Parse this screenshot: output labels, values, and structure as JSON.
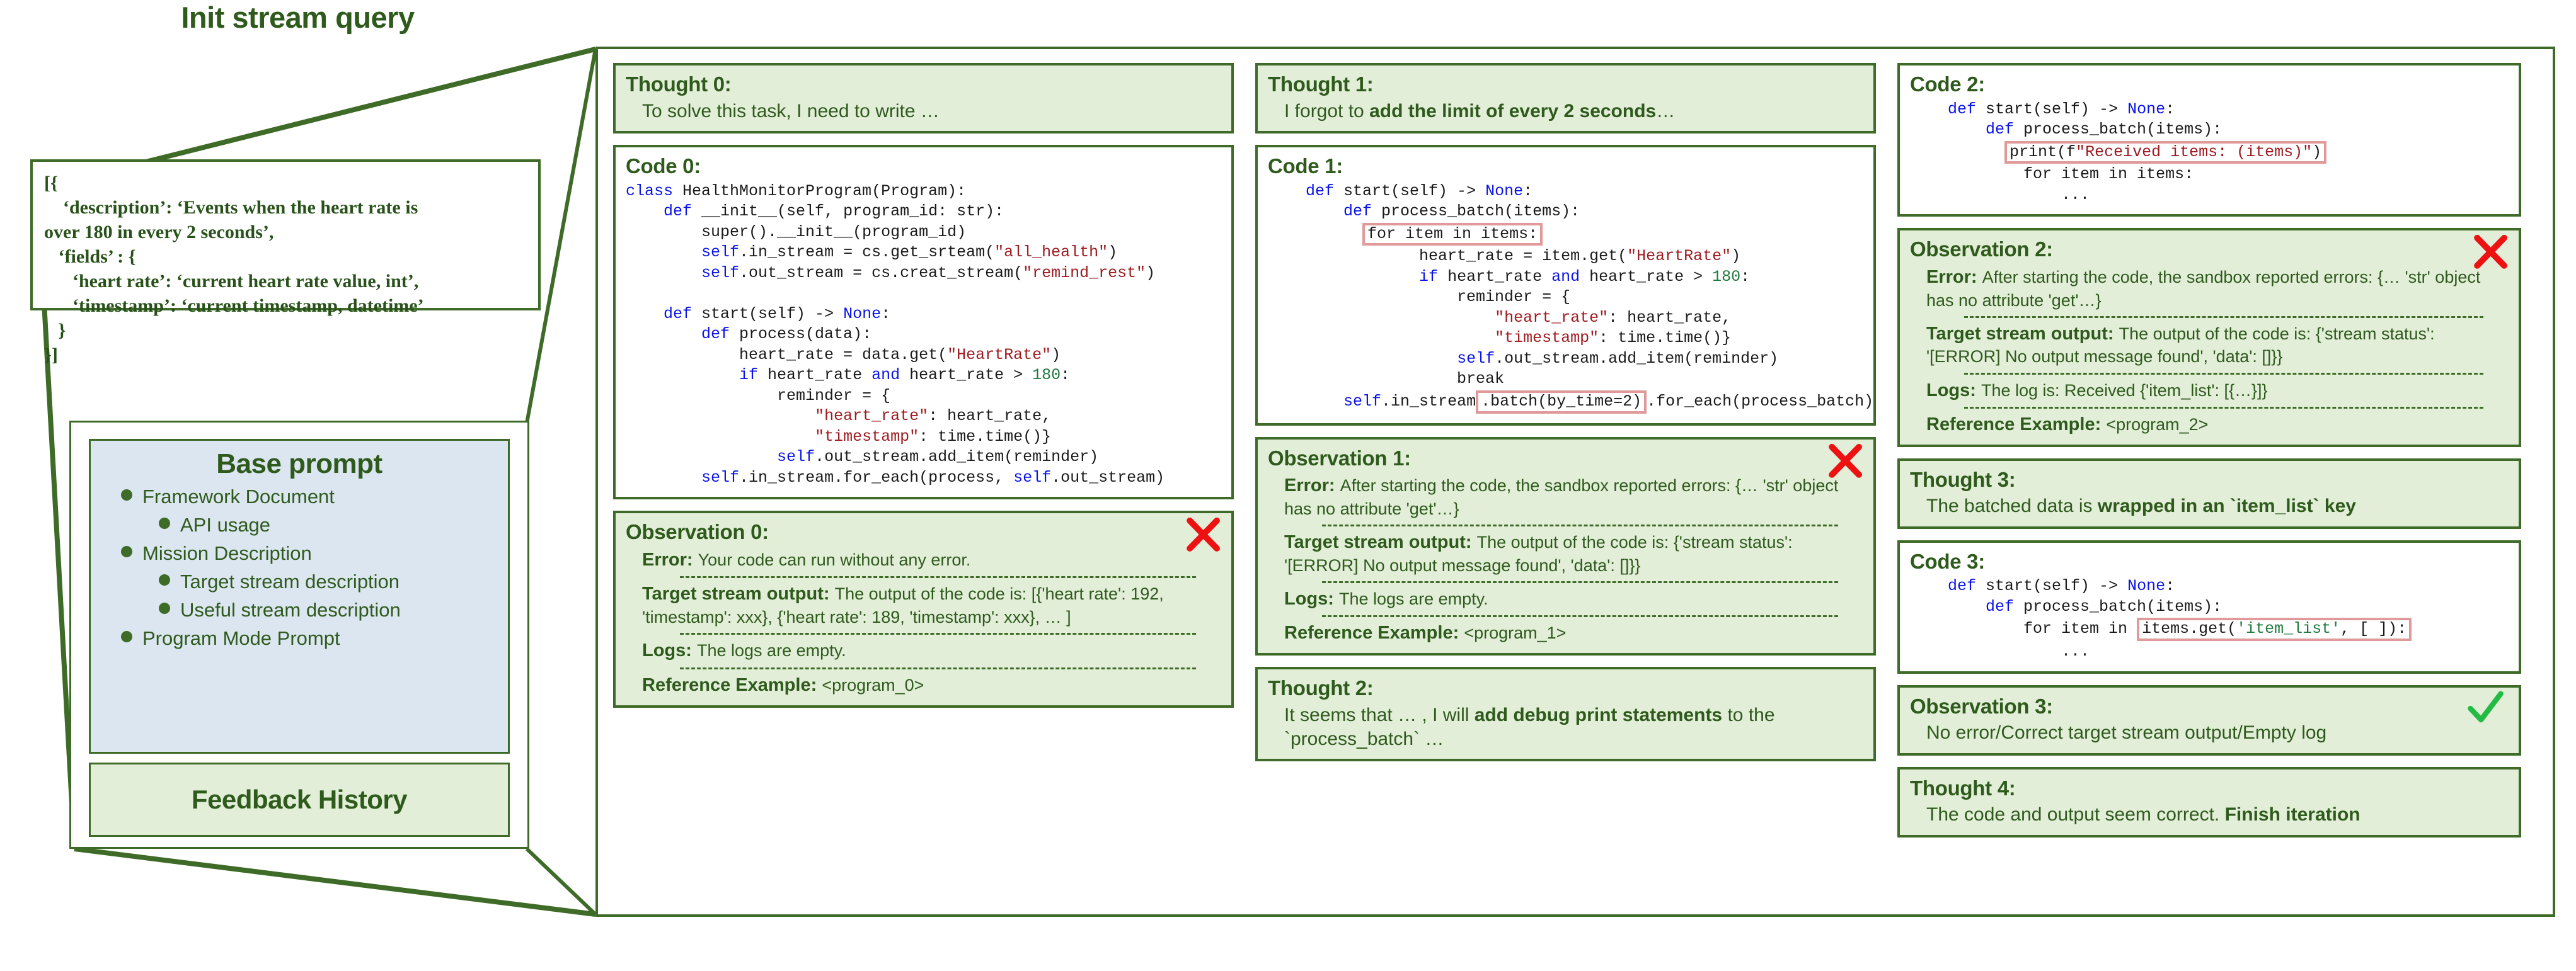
{
  "left": {
    "init_title": "Init stream query",
    "query_text": "[{\n    ‘description’: ‘Events when the heart rate is\nover 180 in every 2 seconds’,\n   ‘fields’ : {\n      ‘heart rate’: ‘current heart rate value, int’,\n      ‘timestamp’: ‘current timestamp, datetime’\n   }\n}]",
    "base_prompt_title": "Base prompt",
    "base_prompt_items": [
      {
        "label": "Framework Document",
        "level": 1
      },
      {
        "label": "API usage",
        "level": 2
      },
      {
        "label": "Mission Description",
        "level": 1
      },
      {
        "label": "Target stream description",
        "level": 2
      },
      {
        "label": "Useful stream description",
        "level": 2
      },
      {
        "label": "Program Mode Prompt",
        "level": 1
      }
    ],
    "feedback_title": "Feedback History"
  },
  "columns": [
    {
      "blocks": [
        {
          "kind": "thought",
          "header": "Thought 0:",
          "body_plain": "To solve this task, I need to write …",
          "body_pre": "To solve this task, I need to write …",
          "body_bold": "",
          "body_post": ""
        },
        {
          "kind": "code",
          "header": "Code 0:",
          "code_lines": [
            [
              {
                "t": "class ",
                "c": "kw"
              },
              {
                "t": "HealthMonitorProgram(Program):",
                "c": ""
              }
            ],
            [
              {
                "t": "    def ",
                "c": "kw"
              },
              {
                "t": "__init__(self, program_id: str):",
                "c": ""
              }
            ],
            [
              {
                "t": "        super().__init__(program_id)",
                "c": ""
              }
            ],
            [
              {
                "t": "        ",
                "c": ""
              },
              {
                "t": "self",
                "c": "kw"
              },
              {
                "t": ".in_stream = cs.get_srteam(",
                "c": ""
              },
              {
                "t": "\"all_health\"",
                "c": "str"
              },
              {
                "t": ")",
                "c": ""
              }
            ],
            [
              {
                "t": "        ",
                "c": ""
              },
              {
                "t": "self",
                "c": "kw"
              },
              {
                "t": ".out_stream = cs.creat_stream(",
                "c": ""
              },
              {
                "t": "\"remind_rest\"",
                "c": "str"
              },
              {
                "t": ")",
                "c": ""
              }
            ],
            [
              {
                "t": "",
                "c": ""
              }
            ],
            [
              {
                "t": "    def ",
                "c": "kw"
              },
              {
                "t": "start(self) -> ",
                "c": ""
              },
              {
                "t": "None",
                "c": "kw"
              },
              {
                "t": ":",
                "c": ""
              }
            ],
            [
              {
                "t": "        def ",
                "c": "kw"
              },
              {
                "t": "process(data):",
                "c": ""
              }
            ],
            [
              {
                "t": "            heart_rate = data.get(",
                "c": ""
              },
              {
                "t": "\"HeartRate\"",
                "c": "str"
              },
              {
                "t": ")",
                "c": ""
              }
            ],
            [
              {
                "t": "            ",
                "c": ""
              },
              {
                "t": "if ",
                "c": "kw"
              },
              {
                "t": "heart_rate ",
                "c": ""
              },
              {
                "t": "and ",
                "c": "kw"
              },
              {
                "t": "heart_rate > ",
                "c": ""
              },
              {
                "t": "180",
                "c": "num"
              },
              {
                "t": ":",
                "c": ""
              }
            ],
            [
              {
                "t": "                reminder = {",
                "c": ""
              }
            ],
            [
              {
                "t": "                    ",
                "c": ""
              },
              {
                "t": "\"heart_rate\"",
                "c": "str"
              },
              {
                "t": ": heart_rate,",
                "c": ""
              }
            ],
            [
              {
                "t": "                    ",
                "c": ""
              },
              {
                "t": "\"timestamp\"",
                "c": "str"
              },
              {
                "t": ": time.time()}",
                "c": ""
              }
            ],
            [
              {
                "t": "                ",
                "c": ""
              },
              {
                "t": "self",
                "c": "kw"
              },
              {
                "t": ".out_stream.add_item(reminder)",
                "c": ""
              }
            ],
            [
              {
                "t": "        ",
                "c": ""
              },
              {
                "t": "self",
                "c": "kw"
              },
              {
                "t": ".in_stream.for_each(process, ",
                "c": ""
              },
              {
                "t": "self",
                "c": "kw"
              },
              {
                "t": ".out_stream)",
                "c": ""
              }
            ]
          ]
        },
        {
          "kind": "observation",
          "header": "Observation 0:",
          "mark": "cross",
          "rows": [
            {
              "label": "Error:",
              "value": "Your code can run without any error."
            },
            {
              "label": "Target stream output:",
              "value": "The output of the code is: [{'heart rate': 192, 'timestamp':  xxx}, {'heart rate': 189, 'timestamp': xxx}, … ]"
            },
            {
              "label": "Logs:",
              "value": "The logs are empty."
            },
            {
              "label": "Reference Example:",
              "value": "<program_0>"
            }
          ]
        }
      ]
    },
    {
      "blocks": [
        {
          "kind": "thought",
          "header": "Thought 1:",
          "body_pre": "I forgot to ",
          "body_bold": "add the limit of every 2 seconds",
          "body_post": "…"
        },
        {
          "kind": "code",
          "header": "Code 1:",
          "code_lines": [
            [
              {
                "t": "    def ",
                "c": "kw"
              },
              {
                "t": "start(self) -> ",
                "c": ""
              },
              {
                "t": "None",
                "c": "kw"
              },
              {
                "t": ":",
                "c": ""
              }
            ],
            [
              {
                "t": "        def ",
                "c": "kw"
              },
              {
                "t": "process_batch(items):",
                "c": ""
              }
            ],
            [
              {
                "t": "          ",
                "c": ""
              },
              {
                "t": "for item in items:",
                "c": "hl"
              }
            ],
            [
              {
                "t": "                heart_rate = item.get(",
                "c": ""
              },
              {
                "t": "\"HeartRate\"",
                "c": "str"
              },
              {
                "t": ")",
                "c": ""
              }
            ],
            [
              {
                "t": "                ",
                "c": ""
              },
              {
                "t": "if ",
                "c": "kw"
              },
              {
                "t": "heart_rate ",
                "c": ""
              },
              {
                "t": "and ",
                "c": "kw"
              },
              {
                "t": "heart_rate > ",
                "c": ""
              },
              {
                "t": "180",
                "c": "num"
              },
              {
                "t": ":",
                "c": ""
              }
            ],
            [
              {
                "t": "                    reminder = {",
                "c": ""
              }
            ],
            [
              {
                "t": "                        ",
                "c": ""
              },
              {
                "t": "\"heart_rate\"",
                "c": "str"
              },
              {
                "t": ": heart_rate,",
                "c": ""
              }
            ],
            [
              {
                "t": "                        ",
                "c": ""
              },
              {
                "t": "\"timestamp\"",
                "c": "str"
              },
              {
                "t": ": time.time()}",
                "c": ""
              }
            ],
            [
              {
                "t": "                    ",
                "c": ""
              },
              {
                "t": "self",
                "c": "kw"
              },
              {
                "t": ".out_stream.add_item(reminder)",
                "c": ""
              }
            ],
            [
              {
                "t": "                    break",
                "c": ""
              }
            ],
            [
              {
                "t": "        ",
                "c": ""
              },
              {
                "t": "self",
                "c": "kw"
              },
              {
                "t": ".in_stream",
                "c": ""
              },
              {
                "t": ".batch(by_time=2)",
                "c": "hl"
              },
              {
                "t": ".for_each(process_batch)",
                "c": ""
              }
            ]
          ]
        },
        {
          "kind": "observation",
          "header": "Observation 1:",
          "mark": "cross",
          "rows": [
            {
              "label": "Error:",
              "value": "After starting the code, the sandbox reported errors: {… 'str' object has no attribute 'get'…}"
            },
            {
              "label": "Target stream output:",
              "value": "The output of the code is: {'stream status': '[ERROR] No output message found', 'data': []}}"
            },
            {
              "label": "Logs:",
              "value": "The logs are empty."
            },
            {
              "label": "Reference Example:",
              "value": "<program_1>"
            }
          ]
        },
        {
          "kind": "thought",
          "header": "Thought 2:",
          "body_pre": "It seems that … , I will ",
          "body_bold": "add debug print statements",
          "body_post": " to the `process_batch` …"
        }
      ]
    },
    {
      "blocks": [
        {
          "kind": "code",
          "header": "Code 2:",
          "code_lines": [
            [
              {
                "t": "    def ",
                "c": "kw"
              },
              {
                "t": "start(self) -> ",
                "c": ""
              },
              {
                "t": "None",
                "c": "kw"
              },
              {
                "t": ":",
                "c": ""
              }
            ],
            [
              {
                "t": "        def ",
                "c": "kw"
              },
              {
                "t": "process_batch(items):",
                "c": ""
              }
            ],
            [
              {
                "t": "          ",
                "c": ""
              },
              {
                "t": "print(f\"Received items: (items)\")",
                "c": "hl-str"
              }
            ],
            [
              {
                "t": "            for item in items:",
                "c": ""
              }
            ],
            [
              {
                "t": "                ...",
                "c": ""
              }
            ]
          ]
        },
        {
          "kind": "observation",
          "header": "Observation 2:",
          "mark": "cross",
          "rows": [
            {
              "label": "Error:",
              "value": "After starting the code, the sandbox reported errors: {… 'str' object has no attribute 'get'…}"
            },
            {
              "label": "Target stream output:",
              "value": "The output of the code is: {'stream status': '[ERROR] No output message found', 'data': []}}"
            },
            {
              "label": "Logs:",
              "value": "The log is: Received {'item_list': [{…}]}"
            },
            {
              "label": "Reference Example:",
              "value": "<program_2>"
            }
          ]
        },
        {
          "kind": "thought",
          "header": "Thought 3:",
          "body_pre": "The batched data is ",
          "body_bold": "wrapped in an `item_list` key",
          "body_post": ""
        },
        {
          "kind": "code",
          "header": "Code 3:",
          "code_lines": [
            [
              {
                "t": "    def ",
                "c": "kw"
              },
              {
                "t": "start(self) -> ",
                "c": ""
              },
              {
                "t": "None",
                "c": "kw"
              },
              {
                "t": ":",
                "c": ""
              }
            ],
            [
              {
                "t": "        def ",
                "c": "kw"
              },
              {
                "t": "process_batch(items):",
                "c": ""
              }
            ],
            [
              {
                "t": "            for item in ",
                "c": ""
              },
              {
                "t": "items.get('item_list', [ ]):",
                "c": "hl-mix"
              }
            ],
            [
              {
                "t": "                ...",
                "c": ""
              }
            ]
          ]
        },
        {
          "kind": "observation",
          "header": "Observation 3:",
          "mark": "check",
          "simple_body": "No error/Correct target stream output/Empty log"
        },
        {
          "kind": "thought",
          "header": "Thought 4:",
          "body_pre": "The code and output seem correct. ",
          "body_bold": "Finish iteration",
          "body_post": ""
        }
      ]
    }
  ],
  "colors": {
    "green_border": "#3e6b27",
    "green_fill": "#e2eed8",
    "green_text": "#2e5a1c",
    "blue_fill": "#dce6f1",
    "code_keyword": "#0b14e8",
    "code_string": "#9e1b20",
    "code_number": "#1f7a3d",
    "highlight_red": "#e09a9a",
    "cross_red": "#ee1111",
    "check_green": "#22bb44"
  }
}
